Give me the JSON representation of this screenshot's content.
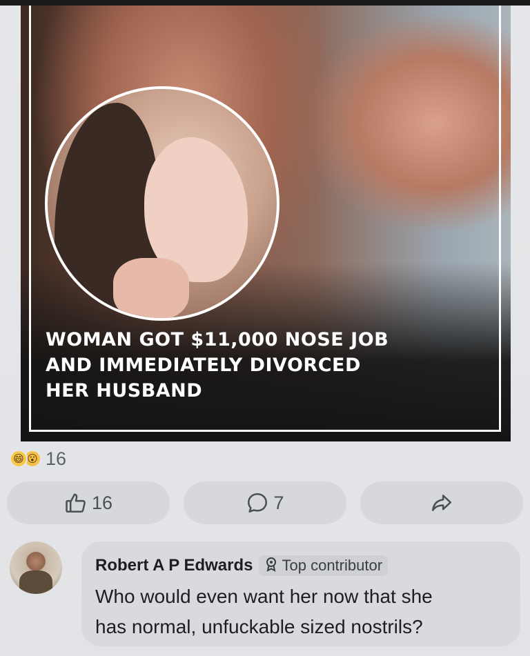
{
  "post": {
    "headline": {
      "line1": "WOMAN GOT $11,000 NOSE JOB",
      "line2": "AND IMMEDIATELY DIVORCED",
      "line3": "HER HUSBAND"
    },
    "reactions": {
      "types": [
        "haha-emoji-icon",
        "wow-emoji-icon"
      ],
      "count": "16"
    },
    "actions": {
      "like": {
        "icon": "thumbs-up-icon",
        "count": "16"
      },
      "comment": {
        "icon": "comment-icon",
        "count": "7"
      },
      "share": {
        "icon": "share-arrow-icon"
      }
    }
  },
  "comment": {
    "author": "Robert A P Edwards",
    "badge": {
      "icon": "award-icon",
      "label": "Top contributor"
    },
    "text": {
      "line1": "Who would even want her now that she",
      "line2": "has normal, unfuckable sized nostrils?"
    }
  }
}
